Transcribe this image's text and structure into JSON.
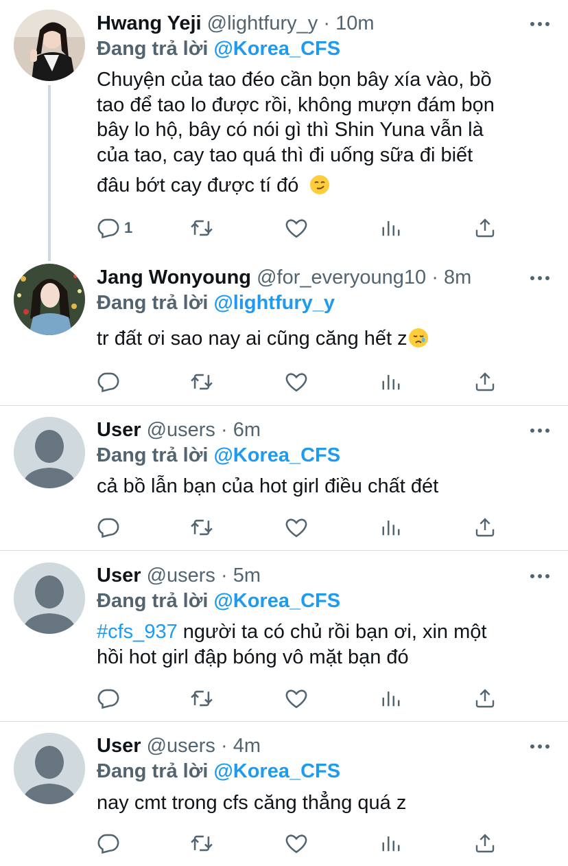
{
  "tweets": [
    {
      "name": "Hwang Yeji",
      "handle": "@lightfury_y",
      "time": "10m",
      "reply_prefix": "Đang trả lời",
      "reply_to": "@Korea_CFS",
      "text_lines": [
        "Chuyện của tao đéo cần bọn bây xía vào, bồ",
        "tao để tao lo được rồi, không mượn đám bọn",
        "bây lo hộ, bây có nói gì thì Shin Yuna vẫn là",
        "của tao, cay tao quá thì đi uống sữa đi biết",
        "đâu bớt cay được tí đó"
      ],
      "reply_count": "1"
    },
    {
      "name": "Jang Wonyoung",
      "handle": "@for_everyoung10",
      "time": "8m",
      "reply_prefix": "Đang trả lời",
      "reply_to": "@lightfury_y",
      "text": "tr đất ơi sao nay ai cũng căng hết z",
      "reply_count": ""
    },
    {
      "name": "User",
      "handle": "@users",
      "time": "6m",
      "reply_prefix": "Đang trả lời",
      "reply_to": "@Korea_CFS",
      "text": "cả bồ lẫn bạn của hot girl điều chất đét",
      "reply_count": ""
    },
    {
      "name": "User",
      "handle": "@users",
      "time": "5m",
      "reply_prefix": "Đang trả lời",
      "reply_to": "@Korea_CFS",
      "hashtag": "#cfs_937",
      "text_line1": " người ta có chủ rồi bạn ơi, xin một",
      "text_line2": "hồi hot girl đập bóng vô mặt bạn đó",
      "reply_count": ""
    },
    {
      "name": "User",
      "handle": "@users",
      "time": "4m",
      "reply_prefix": "Đang trả lời",
      "reply_to": "@Korea_CFS",
      "text": "nay cmt trong cfs căng thẳng quá z",
      "reply_count": ""
    }
  ],
  "separator": "·",
  "icons": [
    "reply-icon",
    "retweet-icon",
    "like-icon",
    "views-icon",
    "share-icon",
    "more-icon"
  ],
  "colors": {
    "accent": "#1d9bf0",
    "secondary_text": "#536471",
    "divider": "#d9dde0"
  }
}
